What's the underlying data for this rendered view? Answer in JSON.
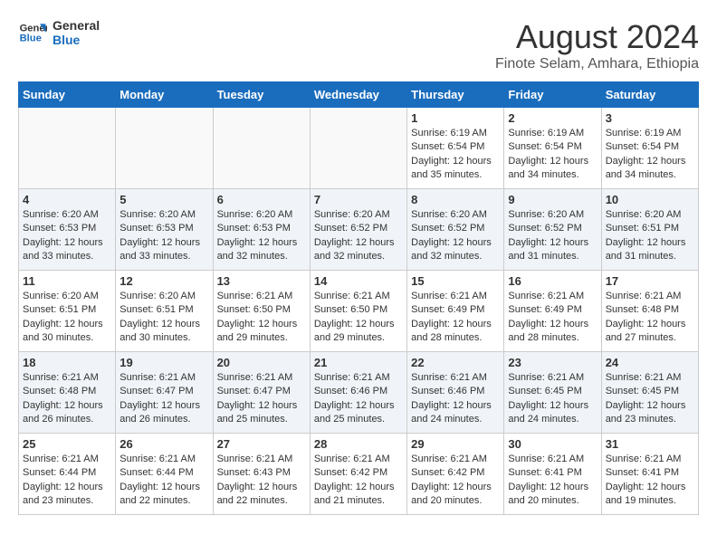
{
  "header": {
    "logo_line1": "General",
    "logo_line2": "Blue",
    "main_title": "August 2024",
    "subtitle": "Finote Selam, Amhara, Ethiopia"
  },
  "weekdays": [
    "Sunday",
    "Monday",
    "Tuesday",
    "Wednesday",
    "Thursday",
    "Friday",
    "Saturday"
  ],
  "weeks": [
    [
      {
        "day": "",
        "detail": ""
      },
      {
        "day": "",
        "detail": ""
      },
      {
        "day": "",
        "detail": ""
      },
      {
        "day": "",
        "detail": ""
      },
      {
        "day": "1",
        "detail": "Sunrise: 6:19 AM\nSunset: 6:54 PM\nDaylight: 12 hours\nand 35 minutes."
      },
      {
        "day": "2",
        "detail": "Sunrise: 6:19 AM\nSunset: 6:54 PM\nDaylight: 12 hours\nand 34 minutes."
      },
      {
        "day": "3",
        "detail": "Sunrise: 6:19 AM\nSunset: 6:54 PM\nDaylight: 12 hours\nand 34 minutes."
      }
    ],
    [
      {
        "day": "4",
        "detail": "Sunrise: 6:20 AM\nSunset: 6:53 PM\nDaylight: 12 hours\nand 33 minutes."
      },
      {
        "day": "5",
        "detail": "Sunrise: 6:20 AM\nSunset: 6:53 PM\nDaylight: 12 hours\nand 33 minutes."
      },
      {
        "day": "6",
        "detail": "Sunrise: 6:20 AM\nSunset: 6:53 PM\nDaylight: 12 hours\nand 32 minutes."
      },
      {
        "day": "7",
        "detail": "Sunrise: 6:20 AM\nSunset: 6:52 PM\nDaylight: 12 hours\nand 32 minutes."
      },
      {
        "day": "8",
        "detail": "Sunrise: 6:20 AM\nSunset: 6:52 PM\nDaylight: 12 hours\nand 32 minutes."
      },
      {
        "day": "9",
        "detail": "Sunrise: 6:20 AM\nSunset: 6:52 PM\nDaylight: 12 hours\nand 31 minutes."
      },
      {
        "day": "10",
        "detail": "Sunrise: 6:20 AM\nSunset: 6:51 PM\nDaylight: 12 hours\nand 31 minutes."
      }
    ],
    [
      {
        "day": "11",
        "detail": "Sunrise: 6:20 AM\nSunset: 6:51 PM\nDaylight: 12 hours\nand 30 minutes."
      },
      {
        "day": "12",
        "detail": "Sunrise: 6:20 AM\nSunset: 6:51 PM\nDaylight: 12 hours\nand 30 minutes."
      },
      {
        "day": "13",
        "detail": "Sunrise: 6:21 AM\nSunset: 6:50 PM\nDaylight: 12 hours\nand 29 minutes."
      },
      {
        "day": "14",
        "detail": "Sunrise: 6:21 AM\nSunset: 6:50 PM\nDaylight: 12 hours\nand 29 minutes."
      },
      {
        "day": "15",
        "detail": "Sunrise: 6:21 AM\nSunset: 6:49 PM\nDaylight: 12 hours\nand 28 minutes."
      },
      {
        "day": "16",
        "detail": "Sunrise: 6:21 AM\nSunset: 6:49 PM\nDaylight: 12 hours\nand 28 minutes."
      },
      {
        "day": "17",
        "detail": "Sunrise: 6:21 AM\nSunset: 6:48 PM\nDaylight: 12 hours\nand 27 minutes."
      }
    ],
    [
      {
        "day": "18",
        "detail": "Sunrise: 6:21 AM\nSunset: 6:48 PM\nDaylight: 12 hours\nand 26 minutes."
      },
      {
        "day": "19",
        "detail": "Sunrise: 6:21 AM\nSunset: 6:47 PM\nDaylight: 12 hours\nand 26 minutes."
      },
      {
        "day": "20",
        "detail": "Sunrise: 6:21 AM\nSunset: 6:47 PM\nDaylight: 12 hours\nand 25 minutes."
      },
      {
        "day": "21",
        "detail": "Sunrise: 6:21 AM\nSunset: 6:46 PM\nDaylight: 12 hours\nand 25 minutes."
      },
      {
        "day": "22",
        "detail": "Sunrise: 6:21 AM\nSunset: 6:46 PM\nDaylight: 12 hours\nand 24 minutes."
      },
      {
        "day": "23",
        "detail": "Sunrise: 6:21 AM\nSunset: 6:45 PM\nDaylight: 12 hours\nand 24 minutes."
      },
      {
        "day": "24",
        "detail": "Sunrise: 6:21 AM\nSunset: 6:45 PM\nDaylight: 12 hours\nand 23 minutes."
      }
    ],
    [
      {
        "day": "25",
        "detail": "Sunrise: 6:21 AM\nSunset: 6:44 PM\nDaylight: 12 hours\nand 23 minutes."
      },
      {
        "day": "26",
        "detail": "Sunrise: 6:21 AM\nSunset: 6:44 PM\nDaylight: 12 hours\nand 22 minutes."
      },
      {
        "day": "27",
        "detail": "Sunrise: 6:21 AM\nSunset: 6:43 PM\nDaylight: 12 hours\nand 22 minutes."
      },
      {
        "day": "28",
        "detail": "Sunrise: 6:21 AM\nSunset: 6:42 PM\nDaylight: 12 hours\nand 21 minutes."
      },
      {
        "day": "29",
        "detail": "Sunrise: 6:21 AM\nSunset: 6:42 PM\nDaylight: 12 hours\nand 20 minutes."
      },
      {
        "day": "30",
        "detail": "Sunrise: 6:21 AM\nSunset: 6:41 PM\nDaylight: 12 hours\nand 20 minutes."
      },
      {
        "day": "31",
        "detail": "Sunrise: 6:21 AM\nSunset: 6:41 PM\nDaylight: 12 hours\nand 19 minutes."
      }
    ]
  ]
}
